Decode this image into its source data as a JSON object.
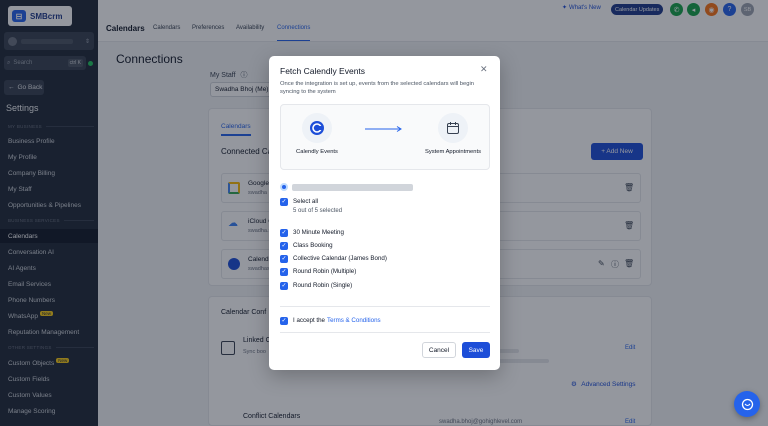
{
  "brand": {
    "name": "SMBcrm"
  },
  "sidebar": {
    "search_placeholder": "Search",
    "search_shortcut": "ctrl K",
    "go_back": "Go Back",
    "settings_title": "Settings",
    "section_my_business": "MY BUSINESS",
    "section_business_services": "BUSINESS SERVICES",
    "section_other_settings": "OTHER SETTINGS",
    "new_badge": "New",
    "items": [
      {
        "label": "Business Profile"
      },
      {
        "label": "My Profile"
      },
      {
        "label": "Company Billing"
      },
      {
        "label": "My Staff"
      },
      {
        "label": "Opportunities & Pipelines"
      },
      {
        "label": "Calendars"
      },
      {
        "label": "Conversation AI"
      },
      {
        "label": "AI Agents"
      },
      {
        "label": "Email Services"
      },
      {
        "label": "Phone Numbers"
      },
      {
        "label": "WhatsApp"
      },
      {
        "label": "Reputation Management"
      },
      {
        "label": "Custom Objects"
      },
      {
        "label": "Custom Fields"
      },
      {
        "label": "Custom Values"
      },
      {
        "label": "Manage Scoring"
      }
    ]
  },
  "topbar": {
    "title": "Calendars",
    "tabs": [
      {
        "label": "Calendars"
      },
      {
        "label": "Preferences"
      },
      {
        "label": "Availability"
      },
      {
        "label": "Connections"
      }
    ],
    "whats_new": "What's New",
    "calendar_updates": "Calendar Updates",
    "avatar_initials": "SB",
    "colors": {
      "phone": "#16a34a",
      "megaphone": "#16a34a",
      "bell": "#f97316",
      "help": "#2563eb",
      "avatar": "#9ca3af"
    }
  },
  "main": {
    "page_title": "Connections",
    "my_staff_label": "My Staff",
    "staff_value": "Swadha Bhoj (Me)",
    "inner_tab": "Calendars",
    "connected_title": "Connected Ca",
    "add_new": "+ Add New",
    "calendar_rows": [
      {
        "name": "Google",
        "sub": "swadha"
      },
      {
        "name": "iCloud C",
        "sub": "swadha.s"
      },
      {
        "name": "Calendi",
        "sub": "swadhas"
      }
    ],
    "calendar_conf_title": "Calendar Conf",
    "linked_title": "Linked C",
    "linked_sub": "Sync boo",
    "edit": "Edit",
    "advanced_settings": "Advanced Settings",
    "conflict_title": "Conflict Calendars",
    "conflict_email": "swadha.bhoj@gohighlevel.com"
  },
  "modal": {
    "title": "Fetch Calendly Events",
    "description": "Once the integration is set up, events from the selected calendars will begin syncing to the system",
    "flow_from": "Calendly Events",
    "flow_to": "System Appointments",
    "select_all": "Select all",
    "count_text": "5 out of 5 selected",
    "events": [
      {
        "label": "30 Minute Meeting"
      },
      {
        "label": "Class Booking"
      },
      {
        "label": "Collective Calendar (James Bond)"
      },
      {
        "label": "Round Robin (Multiple)"
      },
      {
        "label": "Round Robin (Single)"
      }
    ],
    "terms_prefix": "I accept the",
    "terms_link": "Terms & Conditions",
    "cancel": "Cancel",
    "save": "Save",
    "accent": "#1d4ed8"
  }
}
